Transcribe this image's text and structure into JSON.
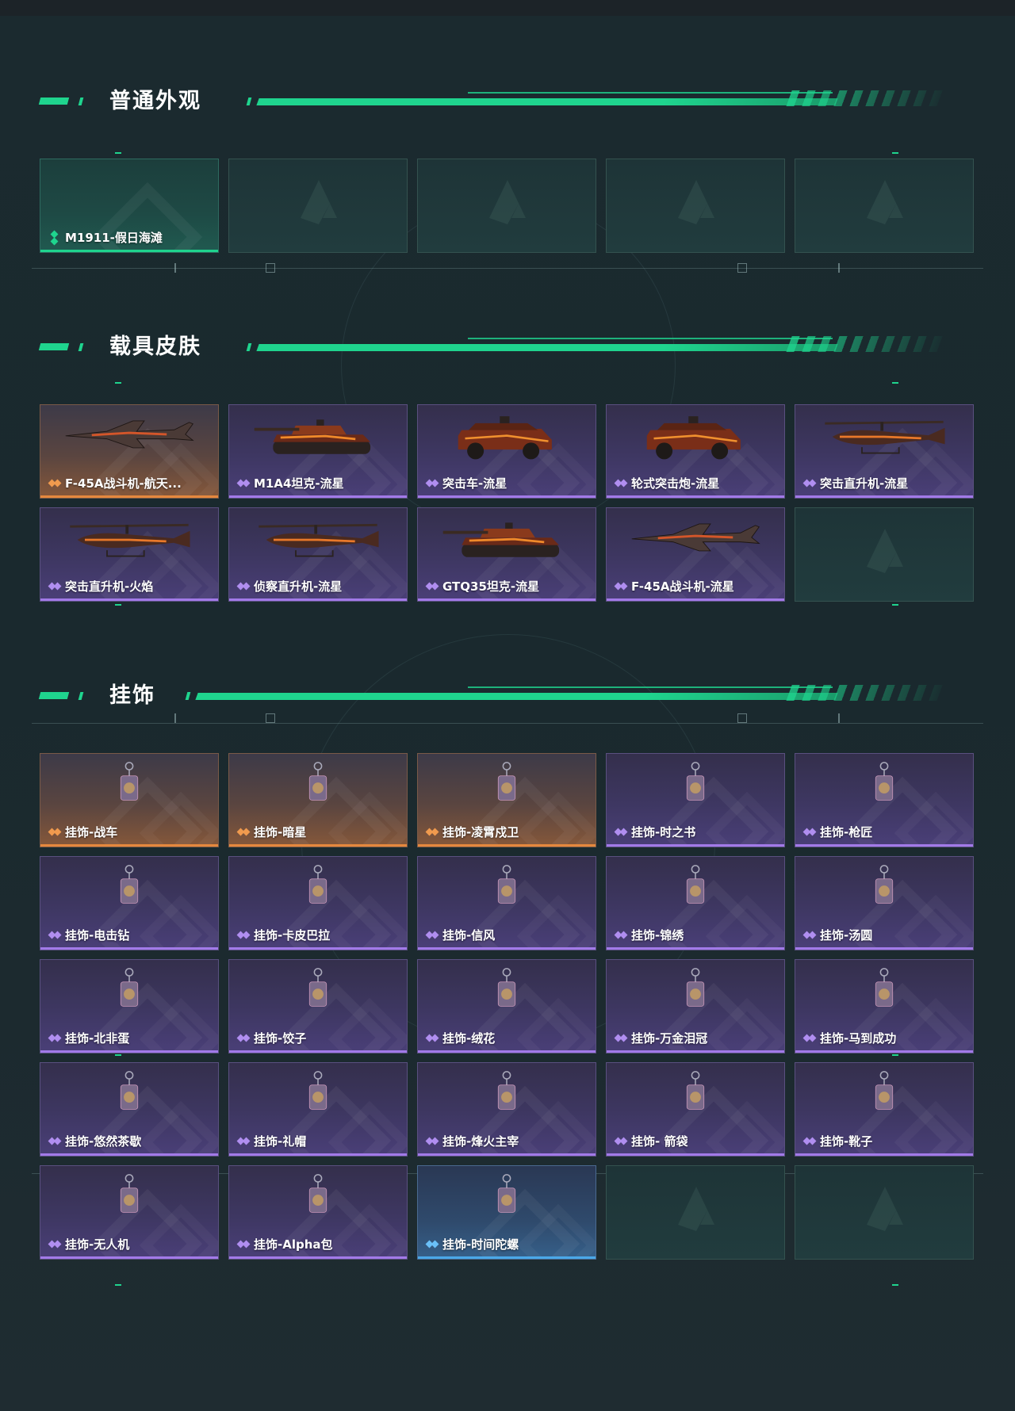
{
  "sections": {
    "s1": {
      "title": "普通外观"
    },
    "s2": {
      "title": "载具皮肤"
    },
    "s3": {
      "title": "挂饰"
    }
  },
  "skins": [
    {
      "label": "M1911-假日海滩",
      "rarity": "green"
    }
  ],
  "vehicles": [
    {
      "label": "F-45A战斗机-航天...",
      "rarity": "orange",
      "icon": "jet-icon"
    },
    {
      "label": "M1A4坦克-流星",
      "rarity": "purple",
      "icon": "tank-icon"
    },
    {
      "label": "突击车-流星",
      "rarity": "purple",
      "icon": "armored-car-icon"
    },
    {
      "label": "轮式突击炮-流星",
      "rarity": "purple",
      "icon": "armored-car-icon"
    },
    {
      "label": "突击直升机-流星",
      "rarity": "purple",
      "icon": "helicopter-icon"
    },
    {
      "label": "突击直升机-火焰",
      "rarity": "purple",
      "icon": "helicopter-icon"
    },
    {
      "label": "侦察直升机-流星",
      "rarity": "purple",
      "icon": "helicopter-icon"
    },
    {
      "label": "GTQ35坦克-流星",
      "rarity": "purple",
      "icon": "tank-icon"
    },
    {
      "label": "F-45A战斗机-流星",
      "rarity": "purple",
      "icon": "jet-icon"
    }
  ],
  "charms": [
    {
      "label": "挂饰-战车",
      "rarity": "orange"
    },
    {
      "label": "挂饰-暗星",
      "rarity": "orange"
    },
    {
      "label": "挂饰-凌霄戍卫",
      "rarity": "orange"
    },
    {
      "label": "挂饰-时之书",
      "rarity": "purple"
    },
    {
      "label": "挂饰-枪匠",
      "rarity": "purple"
    },
    {
      "label": "挂饰-电击钻",
      "rarity": "purple"
    },
    {
      "label": "挂饰-卡皮巴拉",
      "rarity": "purple"
    },
    {
      "label": "挂饰-信风",
      "rarity": "purple"
    },
    {
      "label": "挂饰-锦绣",
      "rarity": "purple"
    },
    {
      "label": "挂饰-汤圆",
      "rarity": "purple"
    },
    {
      "label": "挂饰-北非蛋",
      "rarity": "purple"
    },
    {
      "label": "挂饰-饺子",
      "rarity": "purple"
    },
    {
      "label": "挂饰-绒花",
      "rarity": "purple"
    },
    {
      "label": "挂饰-万金泪冠",
      "rarity": "purple"
    },
    {
      "label": "挂饰-马到成功",
      "rarity": "purple"
    },
    {
      "label": "挂饰-悠然茶歇",
      "rarity": "purple"
    },
    {
      "label": "挂饰-礼帽",
      "rarity": "purple"
    },
    {
      "label": "挂饰-烽火主宰",
      "rarity": "purple"
    },
    {
      "label": "挂饰- 箭袋",
      "rarity": "purple"
    },
    {
      "label": "挂饰-靴子",
      "rarity": "purple"
    },
    {
      "label": "挂饰-无人机",
      "rarity": "purple"
    },
    {
      "label": "挂饰-Alpha包",
      "rarity": "purple"
    },
    {
      "label": "挂饰-时间陀螺",
      "rarity": "blue"
    }
  ],
  "colors": {
    "accent": "#1fd48e",
    "orange": "#e5883e",
    "purple": "#a27ae8",
    "blue": "#4aa8e8"
  }
}
